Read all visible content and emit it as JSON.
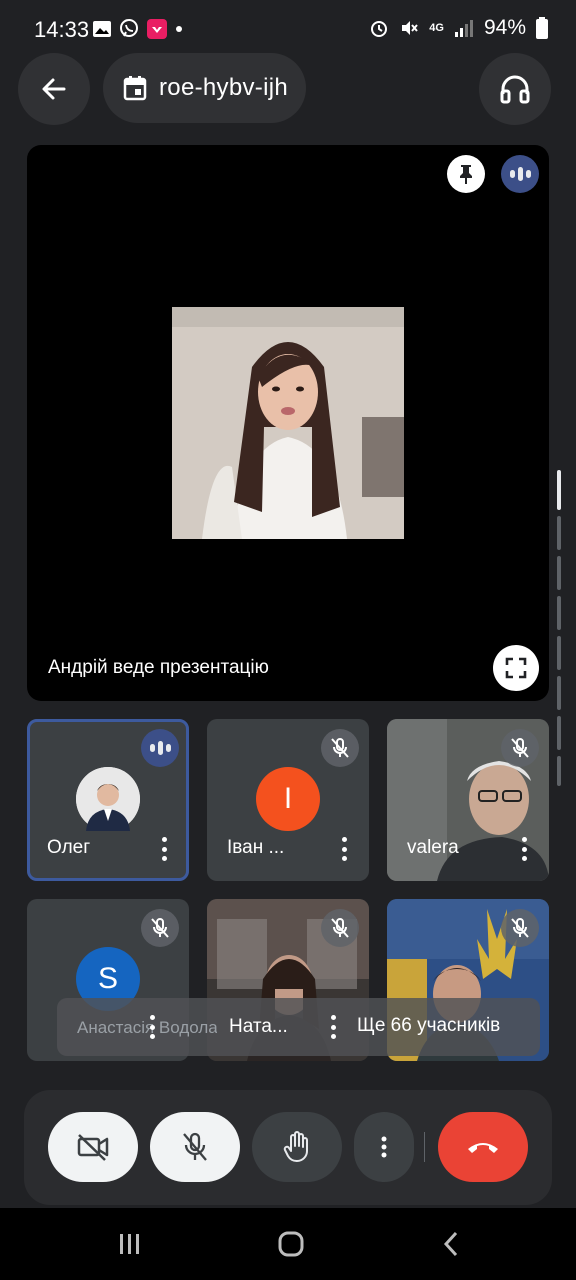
{
  "status_bar": {
    "time": "14:33",
    "battery": "94%",
    "network": "4G"
  },
  "header": {
    "meeting_code": "roe-hybv-ijh"
  },
  "presentation": {
    "presenting_text": "Андрій веде презентацію"
  },
  "participants": [
    {
      "name": "Олег",
      "state": "speaking"
    },
    {
      "name": "Іван ...",
      "initial": "I",
      "color": "#f4511e",
      "state": "muted"
    },
    {
      "name": "valera",
      "state": "muted"
    },
    {
      "name": "Анастасія Водола...",
      "initial": "S",
      "color": "#1565c0",
      "state": "muted"
    },
    {
      "name": "Ната...",
      "state": "muted"
    },
    {
      "name": "",
      "state": "muted"
    }
  ],
  "overflow": {
    "more_label": "Ще 66 учасників"
  },
  "controls": {
    "camera": "camera-off",
    "mic": "mic-off",
    "raise_hand": "hand",
    "more": "more",
    "leave": "end-call"
  },
  "colors": {
    "background": "#202124",
    "speaking": "#3c4f88",
    "end_call": "#ea4335"
  }
}
